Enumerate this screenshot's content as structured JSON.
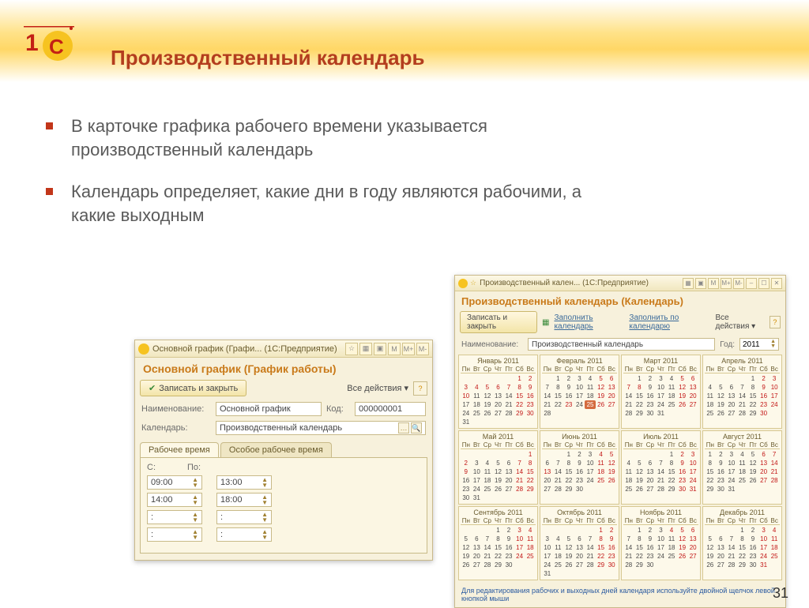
{
  "slide": {
    "title": "Производственный календарь",
    "bullets": [
      "В карточке графика рабочего времени указывается производственный календарь",
      "Календарь определяет, какие дни в году являются рабочими, а какие выходным"
    ],
    "page_number": "31"
  },
  "win1": {
    "window_caption": "Основной график (Графи...   (1С:Предприятие)",
    "heading": "Основной график (График работы)",
    "save_close": "Записать и закрыть",
    "all_actions": "Все действия",
    "rows": {
      "name_label": "Наименование:",
      "name_value": "Основной график",
      "code_label": "Код:",
      "code_value": "000000001",
      "cal_label": "Календарь:",
      "cal_value": "Производственный календарь"
    },
    "tabs": {
      "t1": "Рабочее время",
      "t2": "Особое рабочее время"
    },
    "time": {
      "from": "С:",
      "to": "По:",
      "rows": [
        [
          "09:00",
          "13:00"
        ],
        [
          "14:00",
          "18:00"
        ],
        [
          ":",
          ":"
        ],
        [
          ":",
          ":"
        ]
      ]
    }
  },
  "win2": {
    "window_caption": "Производственный кален...   (1С:Предприятие)",
    "heading": "Производственный календарь (Календарь)",
    "save_close": "Записать и закрыть",
    "fill_cal": "Заполнить календарь",
    "fill_by": "Заполнить по календарю",
    "all_actions": "Все действия",
    "name_label": "Наименование:",
    "name_value": "Производственный календарь",
    "year_label": "Год:",
    "year_value": "2011",
    "dow": [
      "Пн",
      "Вт",
      "Ср",
      "Чт",
      "Пт",
      "Сб",
      "Вс"
    ],
    "footnote": "Для редактирования рабочих и выходных дней календаря используйте двойной щелчок левой кнопкой мыши",
    "months": [
      {
        "title": "Январь 2011",
        "start": 5,
        "count": 31,
        "reds": [
          1,
          2,
          3,
          4,
          5,
          6,
          7,
          8,
          9,
          10,
          15,
          16,
          22,
          23,
          29,
          30
        ]
      },
      {
        "title": "Февраль 2011",
        "start": 1,
        "count": 28,
        "reds": [
          5,
          6,
          12,
          13,
          19,
          20,
          23,
          26,
          27
        ],
        "hl": [
          25
        ]
      },
      {
        "title": "Март 2011",
        "start": 1,
        "count": 31,
        "reds": [
          5,
          6,
          7,
          8,
          12,
          13,
          19,
          20,
          26,
          27
        ]
      },
      {
        "title": "Апрель 2011",
        "start": 4,
        "count": 30,
        "reds": [
          2,
          3,
          9,
          10,
          16,
          17,
          23,
          24,
          30
        ]
      },
      {
        "title": "Май 2011",
        "start": 6,
        "count": 31,
        "reds": [
          1,
          2,
          7,
          8,
          9,
          14,
          15,
          21,
          22,
          28,
          29
        ]
      },
      {
        "title": "Июнь 2011",
        "start": 2,
        "count": 30,
        "reds": [
          4,
          5,
          11,
          12,
          13,
          18,
          19,
          25,
          26
        ]
      },
      {
        "title": "Июль 2011",
        "start": 4,
        "count": 31,
        "reds": [
          2,
          3,
          9,
          10,
          16,
          17,
          23,
          24,
          30,
          31
        ]
      },
      {
        "title": "Август 2011",
        "start": 0,
        "count": 31,
        "reds": [
          6,
          7,
          13,
          14,
          20,
          21,
          27,
          28
        ]
      },
      {
        "title": "Сентябрь 2011",
        "start": 3,
        "count": 30,
        "reds": [
          3,
          4,
          10,
          11,
          17,
          18,
          24,
          25
        ]
      },
      {
        "title": "Октябрь 2011",
        "start": 5,
        "count": 31,
        "reds": [
          1,
          2,
          8,
          9,
          15,
          16,
          22,
          23,
          29,
          30
        ]
      },
      {
        "title": "Ноябрь 2011",
        "start": 1,
        "count": 30,
        "reds": [
          4,
          5,
          6,
          12,
          13,
          19,
          20,
          26,
          27
        ]
      },
      {
        "title": "Декабрь 2011",
        "start": 3,
        "count": 31,
        "reds": [
          3,
          4,
          10,
          11,
          17,
          18,
          24,
          25,
          31
        ]
      }
    ]
  }
}
